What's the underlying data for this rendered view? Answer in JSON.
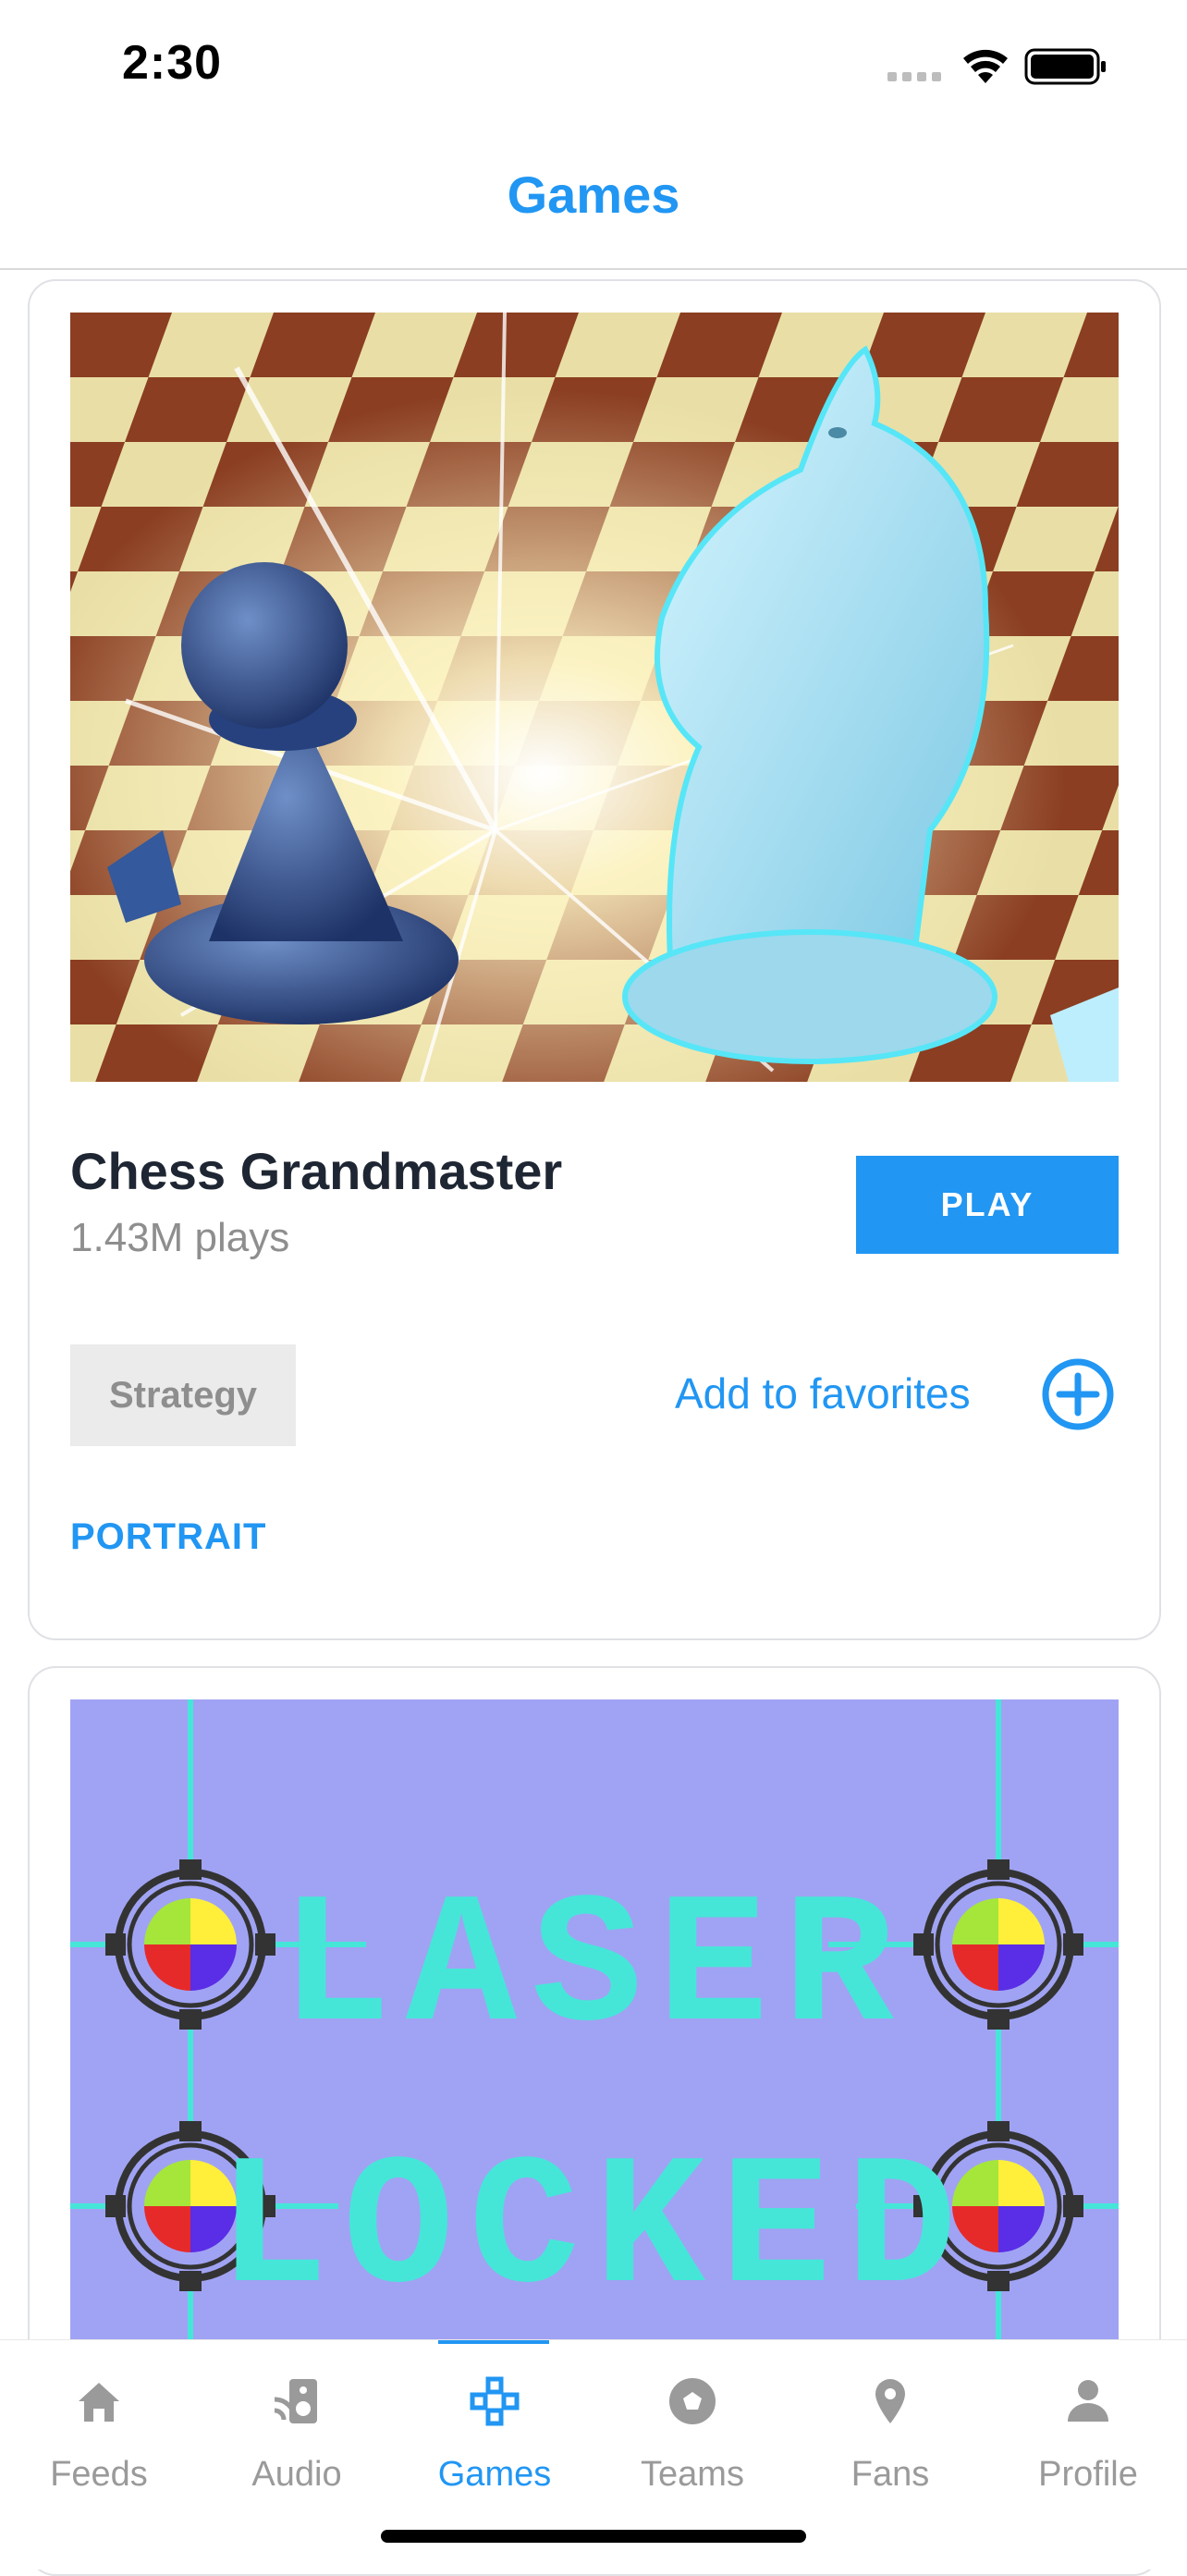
{
  "status": {
    "time": "2:30"
  },
  "nav": {
    "title": "Games"
  },
  "games": [
    {
      "title": "Chess Grandmaster",
      "plays": "1.43M plays",
      "play_label": "PLAY",
      "category": "Strategy",
      "favorites_label": "Add to favorites",
      "orientation": "PORTRAIT"
    },
    {
      "art_text_line1": "LASER",
      "art_text_line2": "LOCKED"
    }
  ],
  "tabs": [
    {
      "label": "Feeds",
      "icon": "home-icon"
    },
    {
      "label": "Audio",
      "icon": "audio-icon"
    },
    {
      "label": "Games",
      "icon": "gamepad-icon",
      "active": true
    },
    {
      "label": "Teams",
      "icon": "soccer-ball-icon"
    },
    {
      "label": "Fans",
      "icon": "location-pin-icon"
    },
    {
      "label": "Profile",
      "icon": "person-icon"
    }
  ],
  "colors": {
    "accent": "#2196f3",
    "laser_bg": "#a0a3f3",
    "laser_line": "#45e6d8"
  }
}
